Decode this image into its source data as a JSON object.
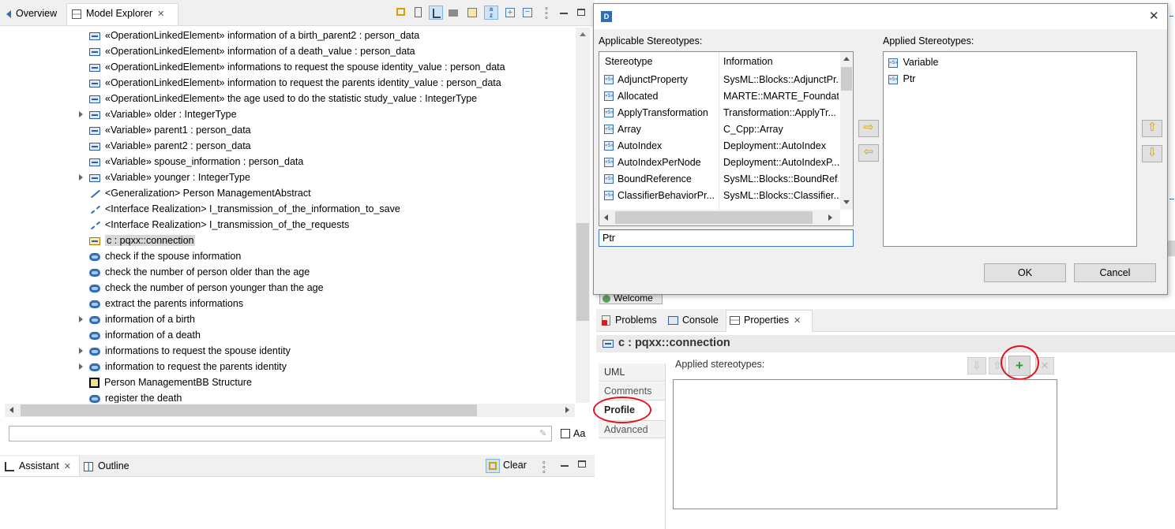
{
  "explorer": {
    "tabs": [
      {
        "label": "Overview"
      },
      {
        "label": "Model Explorer"
      }
    ],
    "tree": [
      {
        "text": "«OperationLinkedElement» information of a birth_parent2 : person_data",
        "icon": "operation-icon",
        "expander": false
      },
      {
        "text": "«OperationLinkedElement» information of a death_value : person_data",
        "icon": "operation-icon",
        "expander": false
      },
      {
        "text": "«OperationLinkedElement» informations to request the spouse identity_value : person_data",
        "icon": "operation-icon",
        "expander": false
      },
      {
        "text": "«OperationLinkedElement» information to request the parents identity_value : person_data",
        "icon": "operation-icon",
        "expander": false
      },
      {
        "text": "«OperationLinkedElement» the age used to do the statistic study_value : IntegerType",
        "icon": "operation-icon",
        "expander": false
      },
      {
        "text": "«Variable» older : IntegerType",
        "icon": "operation-icon",
        "expander": true
      },
      {
        "text": "«Variable» parent1 : person_data",
        "icon": "operation-icon",
        "expander": false
      },
      {
        "text": "«Variable» parent2 : person_data",
        "icon": "operation-icon",
        "expander": false
      },
      {
        "text": "«Variable» spouse_information : person_data",
        "icon": "operation-icon",
        "expander": false
      },
      {
        "text": "«Variable» younger : IntegerType",
        "icon": "operation-icon",
        "expander": true
      },
      {
        "text": "<Generalization> Person ManagementAbstract",
        "icon": "generalization-icon",
        "expander": false
      },
      {
        "text": "<Interface Realization> I_transmission_of_the_information_to_save",
        "icon": "realization-icon",
        "expander": false
      },
      {
        "text": "<Interface Realization> I_transmission_of_the_requests",
        "icon": "realization-icon",
        "expander": false
      },
      {
        "text": "c : pqxx::connection",
        "icon": "connection-icon",
        "expander": false,
        "selected": true
      },
      {
        "text": "check if the spouse information",
        "icon": "behavior-icon",
        "expander": false
      },
      {
        "text": "check the number of person older than the age",
        "icon": "behavior-icon",
        "expander": false
      },
      {
        "text": "check the number of person younger than the age",
        "icon": "behavior-icon",
        "expander": false
      },
      {
        "text": "extract the parents informations",
        "icon": "behavior-icon",
        "expander": false
      },
      {
        "text": "information of a birth",
        "icon": "behavior-icon",
        "expander": true
      },
      {
        "text": "information of a death",
        "icon": "behavior-icon",
        "expander": false
      },
      {
        "text": "informations to request the spouse identity",
        "icon": "behavior-icon",
        "expander": true
      },
      {
        "text": "information to request the parents identity",
        "icon": "behavior-icon",
        "expander": true
      },
      {
        "text": "Person ManagementBB Structure",
        "icon": "structure-icon",
        "expander": false
      },
      {
        "text": "register the death",
        "icon": "behavior-icon",
        "expander": false
      }
    ],
    "filter_value": "",
    "case_label": "Aa"
  },
  "assistant": {
    "tabs": [
      {
        "label": "Assistant"
      },
      {
        "label": "Outline"
      }
    ],
    "clear_label": "Clear"
  },
  "dialog": {
    "applicable_label": "Applicable Stereotypes:",
    "applied_label": "Applied Stereotypes:",
    "columns": [
      "Stereotype",
      "Information"
    ],
    "rows": [
      {
        "name": "AdjunctProperty",
        "info": "SysML::Blocks::AdjunctPr..."
      },
      {
        "name": "Allocated",
        "info": "MARTE::MARTE_Foundat..."
      },
      {
        "name": "ApplyTransformation",
        "info": "Transformation::ApplyTr..."
      },
      {
        "name": "Array",
        "info": "C_Cpp::Array"
      },
      {
        "name": "AutoIndex",
        "info": "Deployment::AutoIndex"
      },
      {
        "name": "AutoIndexPerNode",
        "info": "Deployment::AutoIndexP..."
      },
      {
        "name": "BoundReference",
        "info": "SysML::Blocks::BoundRef..."
      },
      {
        "name": "ClassifierBehaviorPr...",
        "info": "SysML::Blocks::Classifier..."
      }
    ],
    "applied": [
      "Variable",
      "Ptr"
    ],
    "filter_value": "Ptr",
    "ok_label": "OK",
    "cancel_label": "Cancel"
  },
  "editor": {
    "welcome_label": "Welcome"
  },
  "bottom": {
    "tabs": [
      {
        "label": "Problems"
      },
      {
        "label": "Console"
      },
      {
        "label": "Properties"
      }
    ]
  },
  "properties": {
    "title": "c : pqxx::connection",
    "sections": [
      "UML",
      "Comments",
      "Profile",
      "Advanced"
    ],
    "active_section": "Profile",
    "applied_label": "Applied stereotypes:"
  },
  "colors": {
    "annotation": "#e0141e",
    "selection": "#d7d7d7",
    "tab_bg": "#f0f0f0",
    "accent": "#3a6ea8"
  }
}
